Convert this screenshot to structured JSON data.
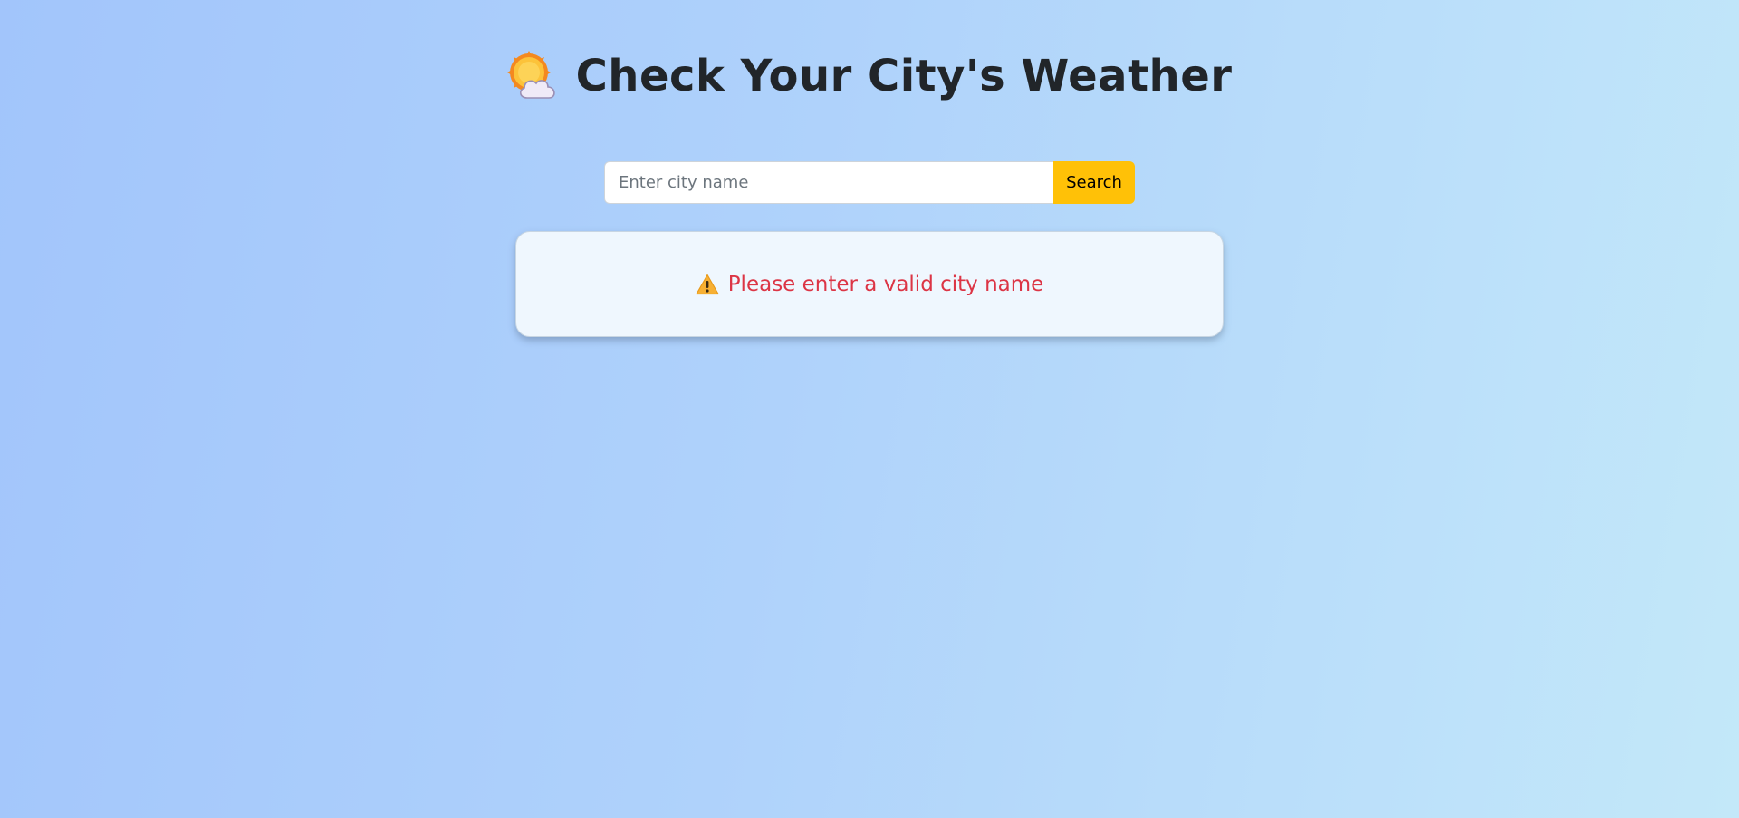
{
  "header": {
    "title": "Check Your City's Weather",
    "icon": "sun-behind-cloud-icon"
  },
  "search": {
    "placeholder": "Enter city name",
    "value": "",
    "button_label": "Search"
  },
  "result": {
    "icon": "warning-icon",
    "message": "Please enter a valid city name"
  },
  "colors": {
    "accent_button": "#ffc107",
    "error_text": "#dc3545",
    "card_background": "#eff7fe",
    "title_text": "#212529"
  }
}
